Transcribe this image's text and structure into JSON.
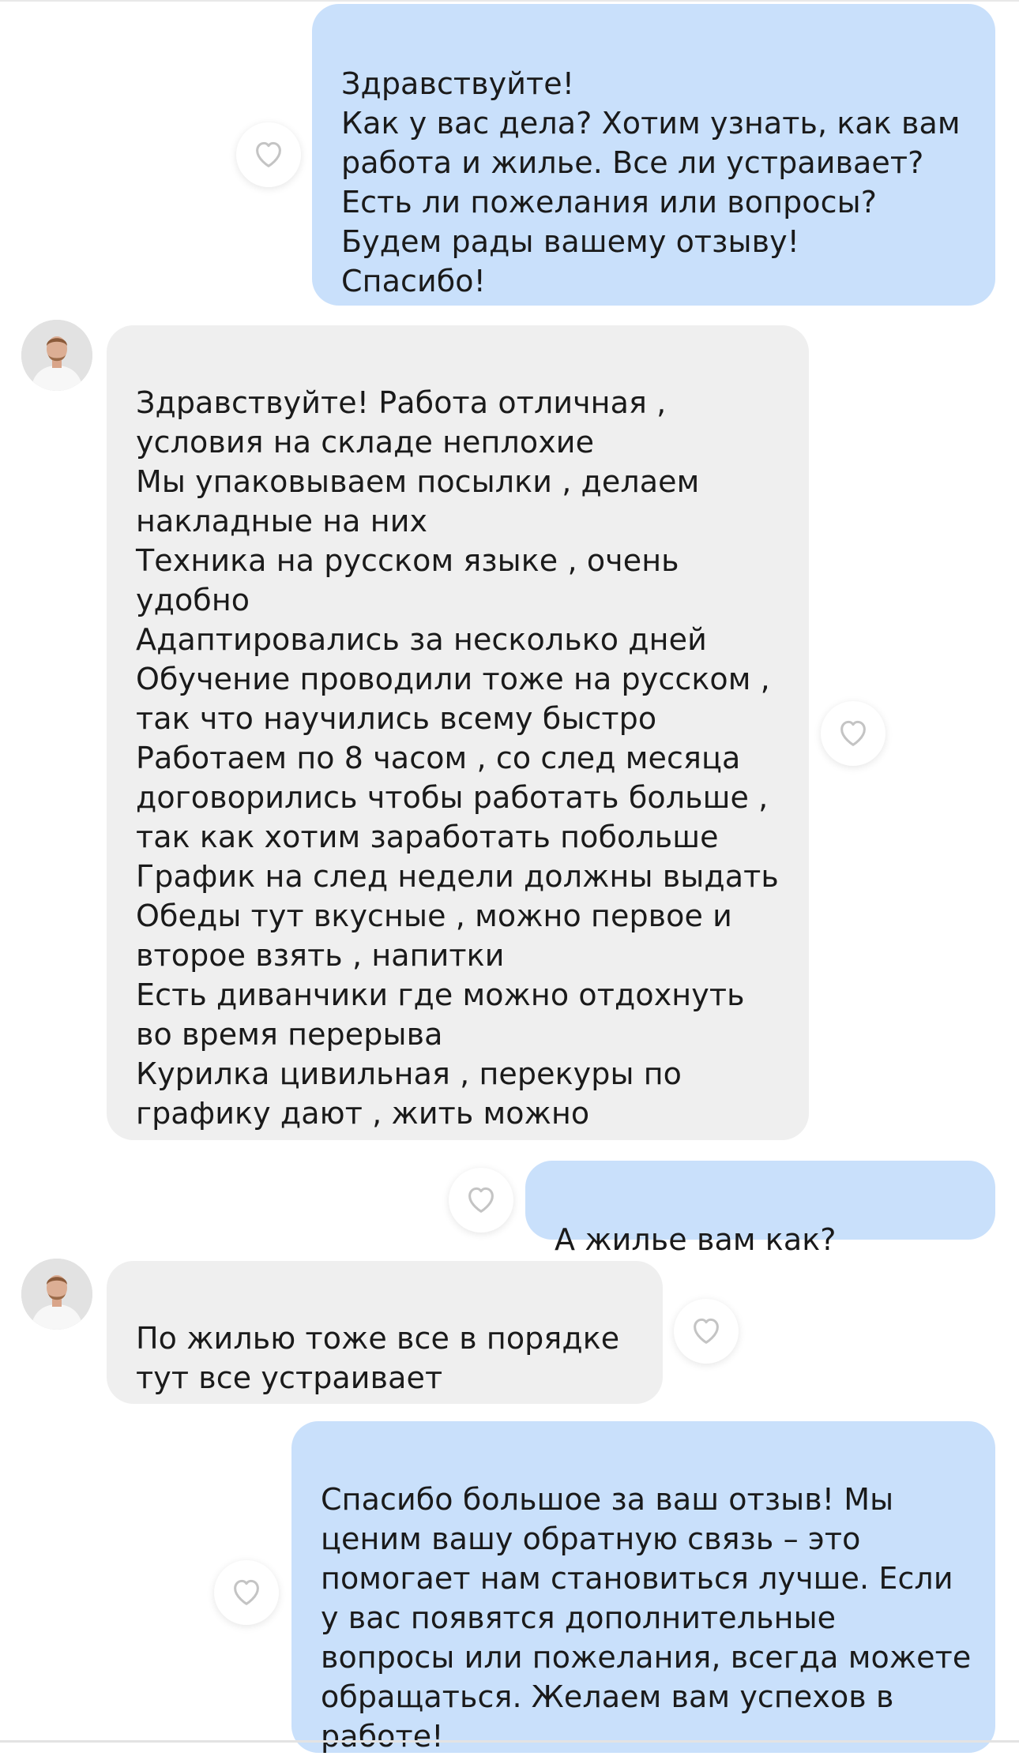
{
  "messages": [
    {
      "id": "m1",
      "sender": "outgoing",
      "text": "Здравствуйте!\nКак у вас дела? Хотим узнать, как вам работа и жилье. Все ли устраивает?\nЕсть ли пожелания или вопросы?\nБудем рады вашему отзыву!\nСпасибо!"
    },
    {
      "id": "m2",
      "sender": "incoming",
      "text": "Здравствуйте! Работа отличная , условия на складе неплохие\nМы упаковываем посылки , делаем накладные на них\nТехника на русском языке , очень удобно\nАдаптировались за несколько дней\nОбучение проводили тоже на русском , так что научились всему быстро\nРаботаем по 8 часом , со след месяца договорились чтобы работать больше , так как хотим заработать побольше\nГрафик на след недели должны выдать\nОбеды тут вкусные , можно первое и второе взять , напитки\nЕсть диванчики где можно отдохнуть во время перерыва\nКурилка цивильная , перекуры по графику дают , жить можно"
    },
    {
      "id": "m3",
      "sender": "outgoing",
      "text": "А жилье вам как?"
    },
    {
      "id": "m4",
      "sender": "incoming",
      "text": "По жилью  тоже все в порядке\nтут все устраивает"
    },
    {
      "id": "m5",
      "sender": "outgoing",
      "text": "Спасибо большое за ваш отзыв! Мы ценим вашу обратную связь – это помогает нам становиться лучше. Если у вас появятся дополнительные вопросы или пожелания, всегда можете обращаться. Желаем вам успехов в работе!"
    }
  ],
  "icons": {
    "like": "heart-outline-icon",
    "avatar": "user-avatar"
  },
  "colors": {
    "outgoing_bubble": "#c9e0fb",
    "incoming_bubble": "#efefef",
    "text": "#1a1a1a",
    "heart_stroke": "#c4c4c4"
  }
}
